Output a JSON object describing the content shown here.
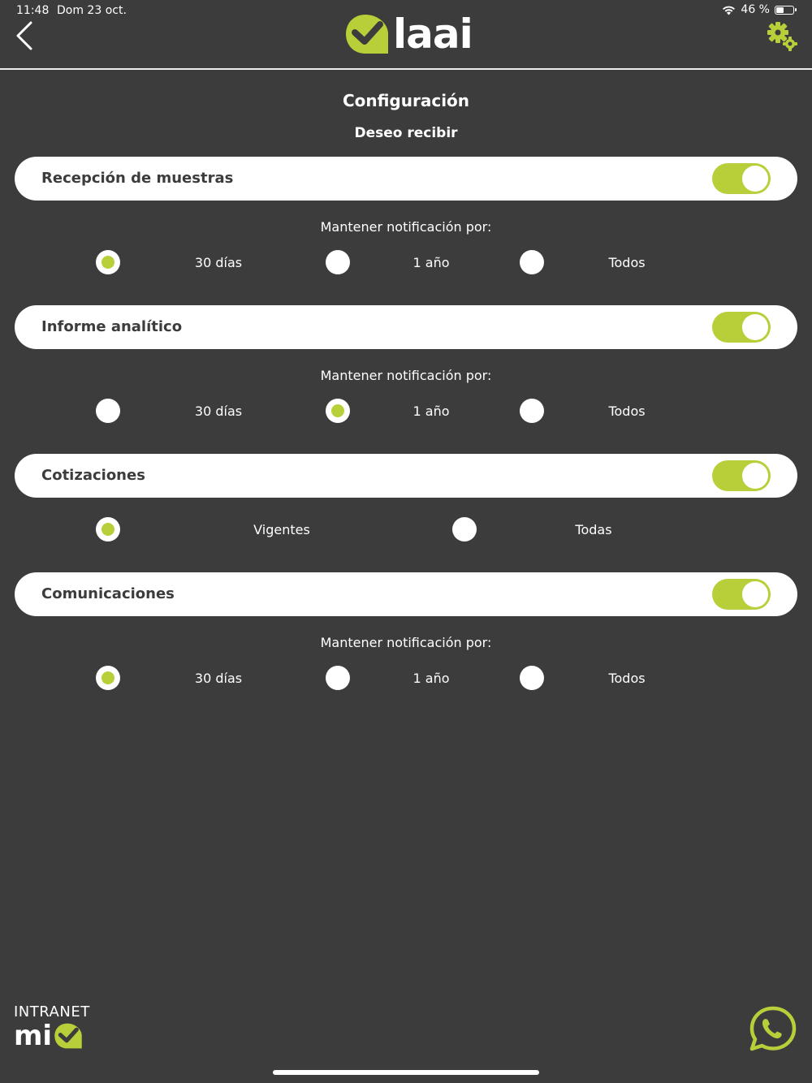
{
  "status_bar": {
    "time": "11:48",
    "date": "Dom 23 oct.",
    "battery_text": "46 %",
    "battery_level": 0.46
  },
  "header": {
    "logo_text": "laai",
    "back_icon": "chevron-left-icon",
    "settings_icon": "gears-icon"
  },
  "title": "Configuración",
  "subtitle": "Deseo recibir",
  "sections": [
    {
      "label": "Recepción de muestras",
      "enabled": true,
      "keep_label": "Mantener notificación por:",
      "options": [
        {
          "label": "30 días",
          "selected": true
        },
        {
          "label": "1 año",
          "selected": false
        },
        {
          "label": "Todos",
          "selected": false
        }
      ]
    },
    {
      "label": "Informe analítico",
      "enabled": true,
      "keep_label": "Mantener notificación por:",
      "options": [
        {
          "label": "30 días",
          "selected": false
        },
        {
          "label": "1 año",
          "selected": true
        },
        {
          "label": "Todos",
          "selected": false
        }
      ]
    },
    {
      "label": "Cotizaciones",
      "enabled": true,
      "options": [
        {
          "label": "Vigentes",
          "selected": true
        },
        {
          "label": "Todas",
          "selected": false
        }
      ]
    },
    {
      "label": "Comunicaciones",
      "enabled": true,
      "keep_label": "Mantener notificación por:",
      "options": [
        {
          "label": "30 días",
          "selected": true
        },
        {
          "label": "1 año",
          "selected": false
        },
        {
          "label": "Todos",
          "selected": false
        }
      ]
    }
  ],
  "footer": {
    "brand_top": "INTRANET",
    "brand_bottom": "mi",
    "whatsapp_icon": "whatsapp-icon"
  },
  "colors": {
    "background": "#3c3c3c",
    "accent": "#b9cf3a",
    "card": "#ffffff",
    "card_text": "#3c3c3c"
  }
}
